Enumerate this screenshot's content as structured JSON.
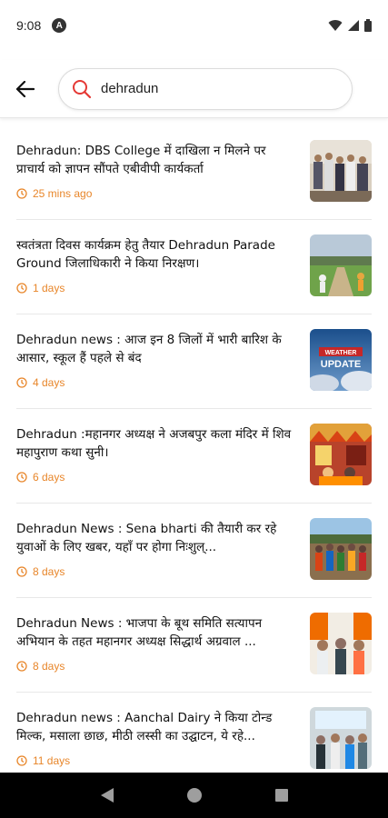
{
  "status_bar": {
    "time": "9:08",
    "app_icon_letter": "A"
  },
  "search": {
    "value": "dehradun"
  },
  "news": [
    {
      "title": "Dehradun: DBS College में दाखिला न मिलने पर प्राचार्य को ज्ञापन सौंपते एबीवीपी कार्यकर्ता",
      "time": "25 mins ago"
    },
    {
      "title": "स्वतंत्रता दिवस कार्यक्रम हेतु तैयार Dehradun Parade Ground जिलाधिकारी ने किया निरक्षण।",
      "time": "1 days"
    },
    {
      "title": "Dehradun news : आज इन 8 जिलों में भारी बारिश के आसार, स्कूल हैं पहले से बंद",
      "time": "4 days",
      "thumb_text": [
        "WEATHER",
        "UPDATE"
      ]
    },
    {
      "title": "Dehradun :महानगर अध्यक्ष ने अजबपुर कला मंदिर में शिव महापुराण कथा सुनी।",
      "time": "6 days"
    },
    {
      "title": "Dehradun News : Sena bharti की तैयारी कर रहे युवाओं के लिए खबर, यहाँ पर होगा  निःशुल्...",
      "time": "8 days"
    },
    {
      "title": "Dehradun News :  भाजपा के बूथ समिति सत्यापन अभियान के तहत महानगर अध्यक्ष सिद्धार्थ अग्रवाल ...",
      "time": "8 days"
    },
    {
      "title": "Dehradun news : Aanchal Dairy ने किया टोन्ड मिल्क, मसाला छाछ, मीठी लस्सी का उद्घाटन, ये रहे...",
      "time": "11 days"
    }
  ],
  "colors": {
    "accent": "#e8862a",
    "search_icon": "#e53935"
  }
}
